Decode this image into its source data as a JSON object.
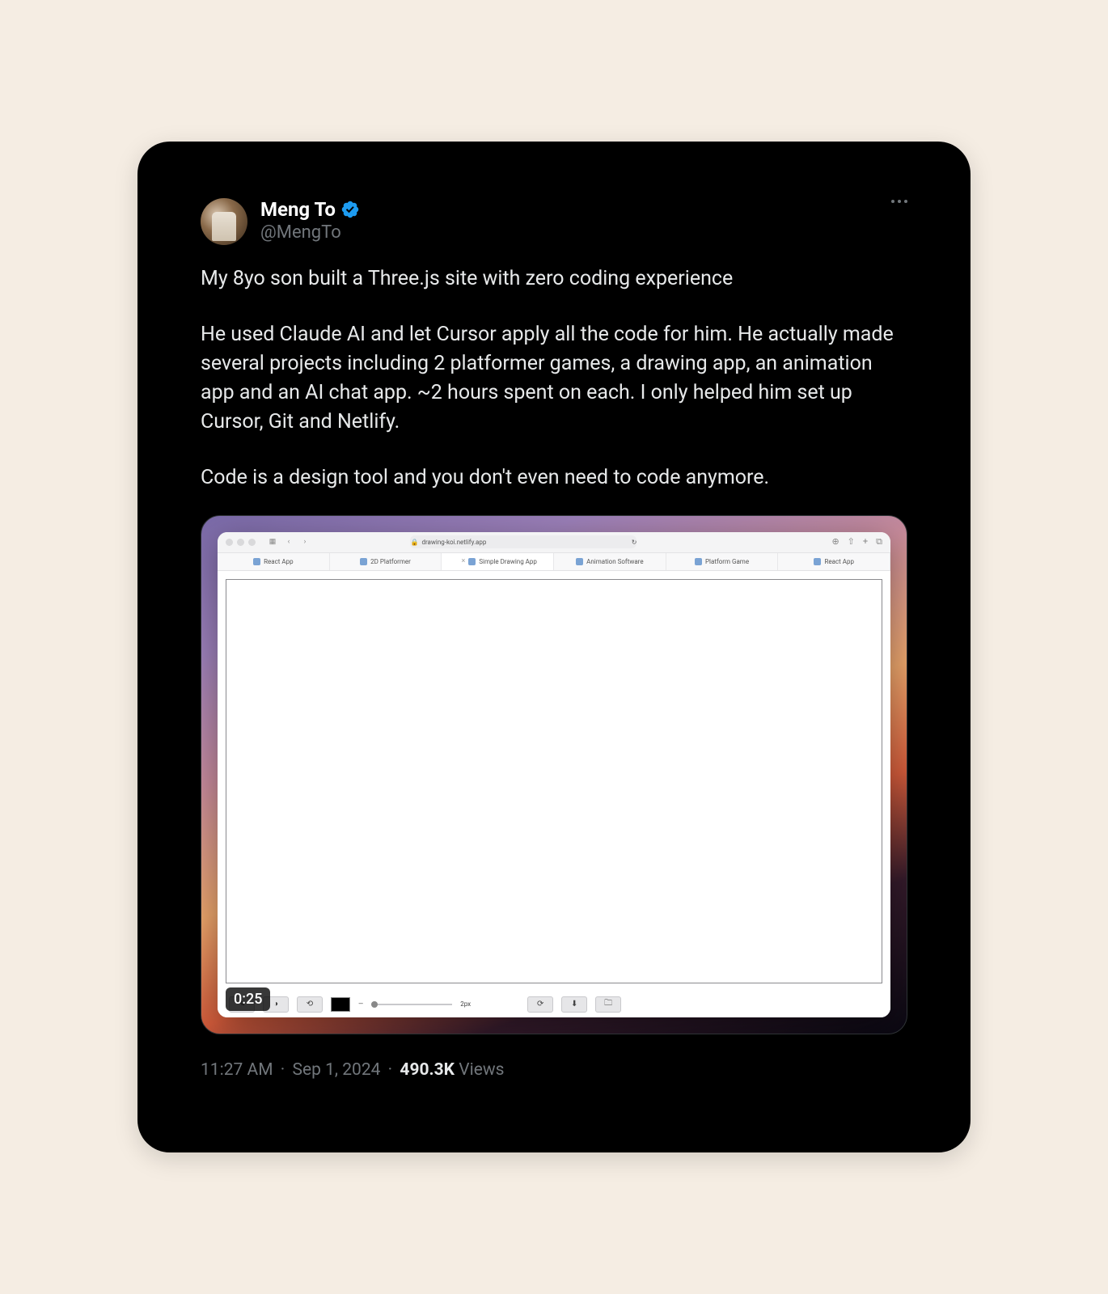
{
  "author": {
    "display_name": "Meng To",
    "handle": "@MengTo"
  },
  "body": {
    "p1": "My 8yo son built a Three.js site with zero coding experience",
    "p2": "He used Claude AI and let Cursor apply all the code for him. He actually made several projects including 2 platformer games, a drawing app, an animation app and an AI chat app. ~2 hours spent on each. I only helped him set up Cursor, Git and Netlify.",
    "p3": "Code is a design tool and you don't even need to code anymore."
  },
  "media": {
    "duration": "0:25",
    "browser": {
      "url": "drawing-koi.netlify.app",
      "tabs": [
        "React App",
        "2D Platformer",
        "Simple Drawing App",
        "Animation Software",
        "Platform Game",
        "React App"
      ],
      "active_tab_index": 2,
      "brush_size_label": "2px"
    }
  },
  "meta": {
    "time": "11:27 AM",
    "date": "Sep 1, 2024",
    "views_count": "490.3K",
    "views_label": "Views"
  }
}
